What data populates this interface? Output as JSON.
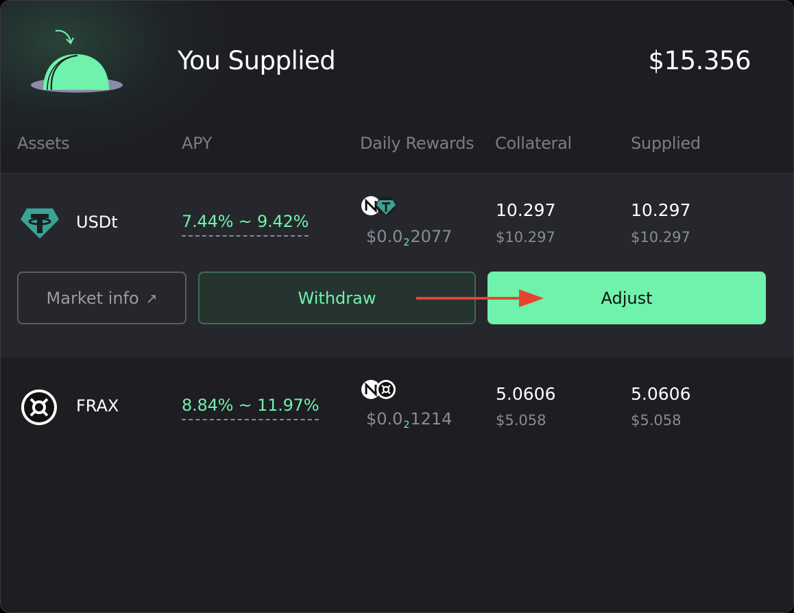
{
  "header": {
    "title": "You Supplied",
    "total": "$15.356"
  },
  "columns": {
    "assets": "Assets",
    "apy": "APY",
    "daily_rewards": "Daily Rewards",
    "collateral": "Collateral",
    "supplied": "Supplied"
  },
  "rows": [
    {
      "asset": "USDt",
      "apy": "7.44% ~ 9.42%",
      "reward_prefix": "$0.0",
      "reward_zeros": "2",
      "reward_suffix": "2077",
      "collateral": "10.297",
      "collateral_usd": "$10.297",
      "supplied": "10.297",
      "supplied_usd": "$10.297"
    },
    {
      "asset": "FRAX",
      "apy": "8.84% ~ 11.97%",
      "reward_prefix": "$0.0",
      "reward_zeros": "2",
      "reward_suffix": "1214",
      "collateral": "5.0606",
      "collateral_usd": "$5.058",
      "supplied": "5.0606",
      "supplied_usd": "$5.058"
    }
  ],
  "actions": {
    "market_info": "Market info",
    "market_info_icon": "↗",
    "withdraw": "Withdraw",
    "adjust": "Adjust"
  },
  "colors": {
    "accent": "#6ff2ac",
    "background": "#1d1d22",
    "row_highlight": "#26272c",
    "annotation_arrow": "#e8432f"
  }
}
